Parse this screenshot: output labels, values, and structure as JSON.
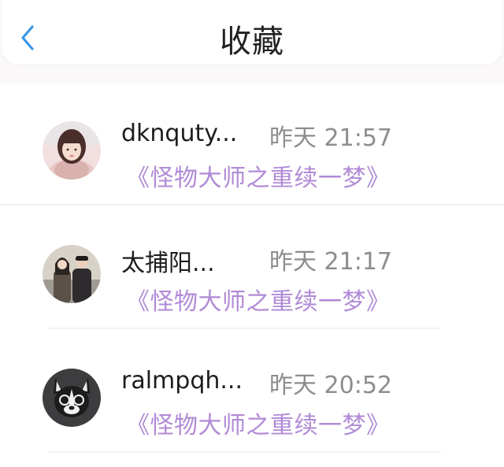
{
  "header": {
    "title": "收藏",
    "back_icon": "chevron-left-icon",
    "accent_color": "#3a97e6"
  },
  "favorites": [
    {
      "name": "dknquty...",
      "time": "昨天 21:57",
      "book": "《怪物大师之重续一梦》",
      "avatar": "girl-avatar"
    },
    {
      "name": "太捕阳...",
      "time": "昨天 21:17",
      "book": "《怪物大师之重续一梦》",
      "avatar": "couple-avatar"
    },
    {
      "name": "ralmpqh...",
      "time": "昨天 20:52",
      "book": "《怪物大师之重续一梦》",
      "avatar": "dog-avatar"
    }
  ],
  "colors": {
    "book_link": "#b08ad6",
    "time_text": "#8d8d8d",
    "name_text": "#1d1d1d"
  }
}
